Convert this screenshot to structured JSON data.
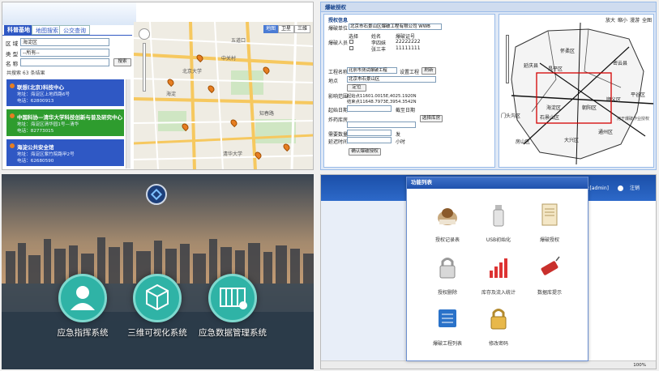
{
  "panel1": {
    "tabs": [
      "科普基地",
      "地图搜索",
      "公交查询"
    ],
    "fields": [
      {
        "label": "区 域",
        "value": "海淀区"
      },
      {
        "label": "类 型",
        "value": "--所有--"
      },
      {
        "label": "名 称",
        "value": ""
      }
    ],
    "search_button": "搜索",
    "results_count_text": "共搜索 63 条结果",
    "cards": [
      {
        "title": "联想(北京)科技中心",
        "addr": "地址：海淀区上地西路6号",
        "tel": "电话：62800913",
        "color": "#2f58c4"
      },
      {
        "title": "中国科协—清华大学科技创新与普及研究中心",
        "addr": "地址：海淀区清华园1号—清华",
        "tel": "电话：82773015",
        "color": "#2e9c2e"
      },
      {
        "title": "海淀公共安全馆",
        "addr": "地址：海淀区紫竹院路甲2号",
        "tel": "电话：62680590",
        "color": "#2f58c4"
      }
    ],
    "map_tabs": [
      "地图",
      "卫星",
      "三维"
    ],
    "map_places": [
      "中关村",
      "海淀",
      "知春路",
      "五道口",
      "北京大学",
      "清华大学"
    ]
  },
  "panel2": {
    "title": "爆破授权",
    "section_title": "授权信息",
    "unit_label": "爆破单位",
    "unit_value": "北京市石景山区爆破工程有限公司 WWB",
    "person_label": "爆破人员",
    "person_headers": [
      "选择",
      "姓名",
      "爆破证号"
    ],
    "persons": [
      {
        "name": "李四妹",
        "cert": "22222222"
      },
      {
        "name": "张三丰",
        "cert": "11111111"
      }
    ],
    "project_label": "工程名称",
    "project_value": "北京市测试爆破工程",
    "project_btn1": "设置工程",
    "project_btn2": "刷新",
    "place_label": "地点",
    "place_value": "北京市石景山区",
    "locate_btn": "定位",
    "range_label": "影响范围",
    "range_lines": [
      "起始点11601.0015E,4025.1920N",
      "结束点11648.7973E,3954.3542N"
    ],
    "start_label": "起始日期",
    "end_label": "截至日期",
    "explosive_label": "炸药库房",
    "select_depot_btn": "选择库房",
    "need_label": "需要数量",
    "need_unit": "发",
    "delay_label": "延迟时间",
    "delay_unit": "小时",
    "confirm_btn": "确认爆破授权",
    "map_tools": [
      "放大",
      "缩小",
      "漫游",
      "全图"
    ],
    "map_places": [
      "怀柔区",
      "延庆县",
      "昌平区",
      "密云县",
      "平谷区",
      "顺义区",
      "海淀区",
      "朝阳区",
      "门头沟区",
      "石景山区",
      "通州区",
      "房山区",
      "大兴区"
    ],
    "map_note": "用于爆破作业授权"
  },
  "panel3": {
    "items": [
      "应急指挥系统",
      "三维可视化系统",
      "应急数据管理系统"
    ]
  },
  "panel4": {
    "header_right": "当前登录用户:[admin]",
    "logout": "注销",
    "dialog_title": "功能列表",
    "icons": [
      "授权记录表",
      "USB初始化",
      "爆破授权",
      "授权删除",
      "库存及流入统计",
      "数据库提示",
      "爆破工程列表",
      "修改密码"
    ],
    "status_zoom": "100%"
  },
  "colors": {
    "accent_blue": "#2f58c4",
    "accent_green": "#2e9c2e",
    "teal": "#2fb3a6"
  }
}
